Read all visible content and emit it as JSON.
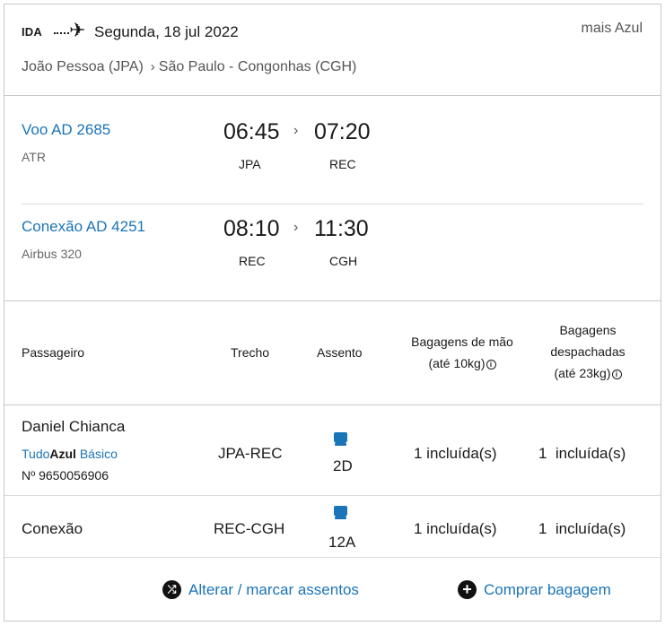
{
  "header": {
    "direction": "IDA",
    "plane_glyph": "✈",
    "date": "Segunda, 18 jul 2022",
    "program": "mais Azul",
    "origin": "João Pessoa (JPA)",
    "route_chevron": "›",
    "destination": "São Paulo - Congonhas (CGH)"
  },
  "segments": [
    {
      "flight": "Voo AD 2685",
      "aircraft": "ATR",
      "dep_time": "06:45",
      "arr_time": "07:20",
      "dep_airport": "JPA",
      "arr_airport": "REC",
      "chevron": "›"
    },
    {
      "flight": "Conexão AD 4251",
      "aircraft": "Airbus 320",
      "dep_time": "08:10",
      "arr_time": "11:30",
      "dep_airport": "REC",
      "arr_airport": "CGH",
      "chevron": "›"
    }
  ],
  "table": {
    "headers": {
      "passenger": "Passageiro",
      "leg": "Trecho",
      "seat": "Assento",
      "hand_line1": "Bagagens de mão",
      "hand_line2": "(até 10kg)",
      "checked_line1": "Bagagens",
      "checked_line2": "despachadas",
      "checked_line3": "(até 23kg)",
      "info_glyph": "i"
    },
    "rows": [
      {
        "name": "Daniel Chianca",
        "tier_prefix": "Tudo",
        "tier_brand": "Azul",
        "tier_level": "Básico",
        "member_number": "Nº 9650056906",
        "leg": "JPA-REC",
        "seat": "2D",
        "hand": "1 incluída(s)",
        "checked": "1  incluída(s)"
      },
      {
        "name": "Conexão",
        "leg": "REC-CGH",
        "seat": "12A",
        "hand": "1 incluída(s)",
        "checked": "1  incluída(s)"
      }
    ]
  },
  "actions": {
    "change_seats_icon": "shuffle-icon",
    "change_seats_glyph": "⤮",
    "change_seats": "Alterar / marcar assentos",
    "buy_baggage_icon": "plus-icon",
    "buy_baggage_glyph": "+",
    "buy_baggage": "Comprar bagagem"
  },
  "colors": {
    "link": "#1a74b8",
    "text": "#1a1a1a",
    "muted": "#555555",
    "border": "#c8c8c8"
  }
}
